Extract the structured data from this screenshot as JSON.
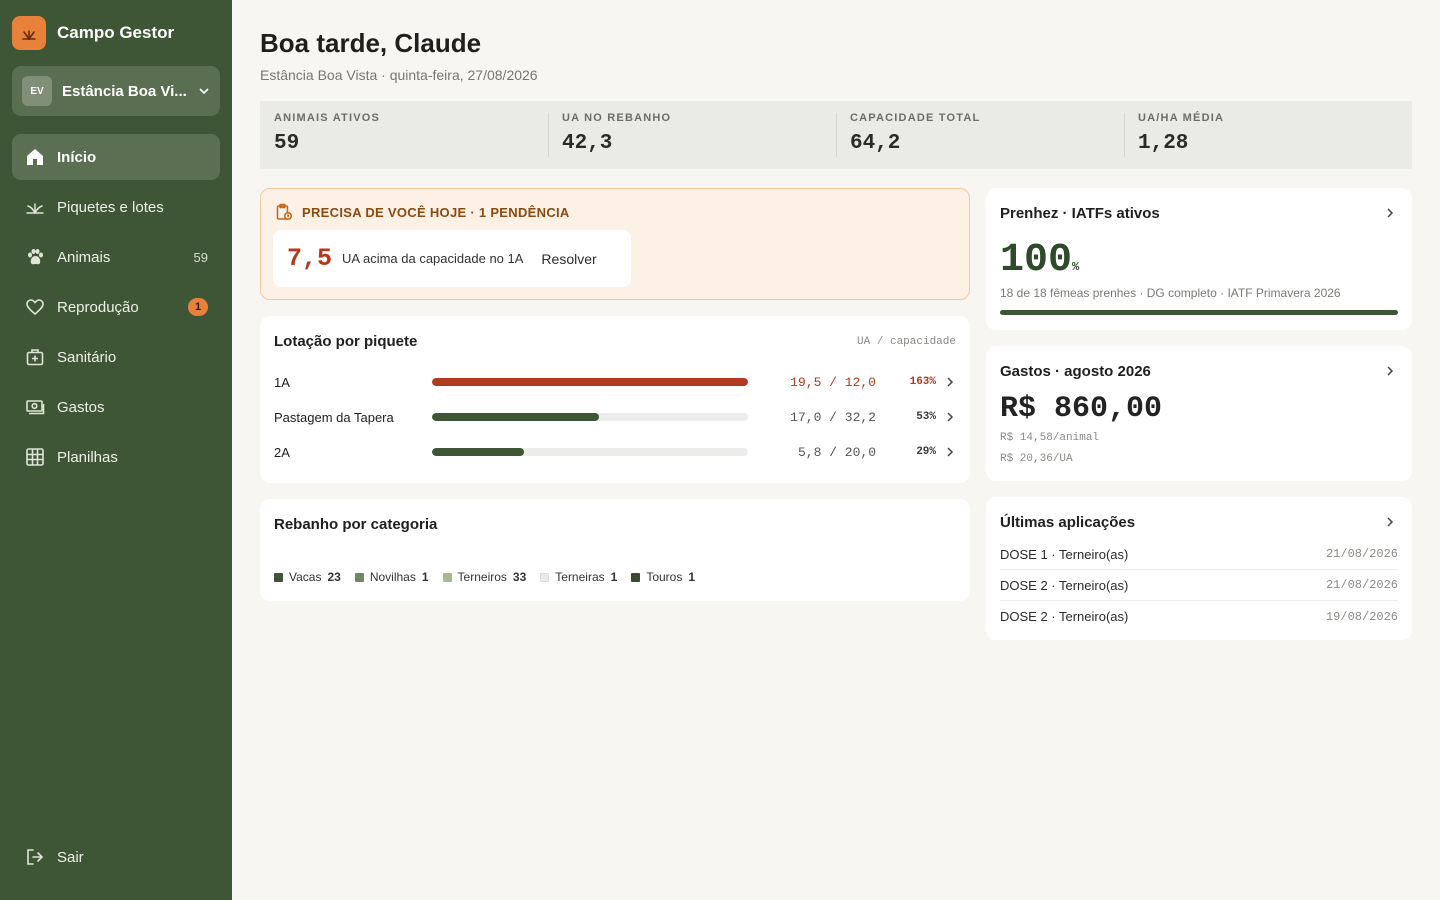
{
  "brand": {
    "name": "Campo Gestor"
  },
  "farm": {
    "initials": "EV",
    "name": "Estância Boa Vi..."
  },
  "nav": [
    {
      "label": "Início",
      "icon": "home-icon",
      "active": true
    },
    {
      "label": "Piquetes e lotes",
      "icon": "grass-icon"
    },
    {
      "label": "Animais",
      "icon": "paw-icon",
      "count": "59"
    },
    {
      "label": "Reprodução",
      "icon": "heart-icon",
      "badge": "1"
    },
    {
      "label": "Sanitário",
      "icon": "medkit-icon"
    },
    {
      "label": "Gastos",
      "icon": "money-icon"
    },
    {
      "label": "Planilhas",
      "icon": "grid-icon"
    }
  ],
  "logout": {
    "label": "Sair"
  },
  "header": {
    "greeting": "Boa tarde, Claude",
    "subtitle": "Estância Boa Vista · quinta-feira, 27/08/2026"
  },
  "kpis": [
    {
      "label": "ANIMAIS ATIVOS",
      "value": "59"
    },
    {
      "label": "UA NO REBANHO",
      "value": "42,3"
    },
    {
      "label": "CAPACIDADE TOTAL",
      "value": "64,2"
    },
    {
      "label": "UA/HA MÉDIA",
      "value": "1,28"
    }
  ],
  "alert": {
    "title": "PRECISA DE VOCÊ HOJE · 1 PENDÊNCIA",
    "value": "7,5",
    "text": "UA acima da capacidade no 1A",
    "action": "Resolver"
  },
  "lotacao": {
    "title": "Lotação por piquete",
    "legend": "UA / capacidade",
    "rows": [
      {
        "name": "1A",
        "value": "19,5 / 12,0",
        "pct": "163%",
        "fill": 1.0,
        "color": "#b23a1e",
        "over": true
      },
      {
        "name": "Pastagem da Tapera",
        "value": "17,0 / 32,2",
        "pct": "53%",
        "fill": 0.53,
        "color": "#3e5636"
      },
      {
        "name": "2A",
        "value": "5,8 / 20,0",
        "pct": "29%",
        "fill": 0.29,
        "color": "#3e5636"
      }
    ]
  },
  "rebanho": {
    "title": "Rebanho por categoria",
    "items": [
      {
        "label": "Vacas",
        "count": "23",
        "color": "#3e5636"
      },
      {
        "label": "Novilhas",
        "count": "1",
        "color": "#6f8a63"
      },
      {
        "label": "Terneiros",
        "count": "33",
        "color": "#a9b98f"
      },
      {
        "label": "Terneiras",
        "count": "1",
        "color": "#ebebe6"
      },
      {
        "label": "Touros",
        "count": "1",
        "color": "#3a4a34"
      }
    ]
  },
  "prenhez": {
    "title": "Prenhez · IATFs ativos",
    "value": "100",
    "unit": "%",
    "detail": "18 de 18 fêmeas prenhes · DG completo · IATF Primavera 2026",
    "progress": 1.0
  },
  "gastos": {
    "title": "Gastos · agosto 2026",
    "value": "R$ 860,00",
    "per_animal": "R$ 14,58/animal",
    "per_ua": "R$ 20,36/UA"
  },
  "aplicacoes": {
    "title": "Últimas aplicações",
    "rows": [
      {
        "name": "DOSE 1 · Terneiro(as)",
        "date": "21/08/2026"
      },
      {
        "name": "DOSE 2 · Terneiro(as)",
        "date": "21/08/2026"
      },
      {
        "name": "DOSE 2 · Terneiro(as)",
        "date": "19/08/2026"
      }
    ]
  },
  "colors": {
    "sidebar": "#3e5636",
    "accent": "#e8823a",
    "danger": "#b23a1e"
  }
}
